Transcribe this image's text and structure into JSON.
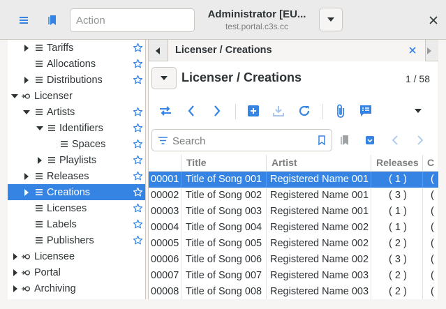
{
  "header": {
    "action_placeholder": "Action",
    "title": "Administrator [EU...",
    "subtitle": "test.portal.c3s.cc"
  },
  "tree": {
    "items": [
      {
        "label": "Tariffs"
      },
      {
        "label": "Allocations"
      },
      {
        "label": "Distributions"
      },
      {
        "label": "Licenser"
      },
      {
        "label": "Artists"
      },
      {
        "label": "Identifiers"
      },
      {
        "label": "Spaces"
      },
      {
        "label": "Playlists"
      },
      {
        "label": "Releases"
      },
      {
        "label": "Creations"
      },
      {
        "label": "Licenses"
      },
      {
        "label": "Labels"
      },
      {
        "label": "Publishers"
      },
      {
        "label": "Licensee"
      },
      {
        "label": "Portal"
      },
      {
        "label": "Archiving"
      }
    ]
  },
  "tab": {
    "label": "Licenser / Creations"
  },
  "view": {
    "title": "Licenser / Creations",
    "counter": "1 / 58"
  },
  "search": {
    "placeholder": "Search"
  },
  "table": {
    "columns": [
      "Title",
      "Artist",
      "Releases",
      "C"
    ],
    "rows": [
      {
        "code": "00001",
        "title": "Title of Song 001",
        "artist": "Registered Name 001",
        "releases": "( 1 )",
        "c": "("
      },
      {
        "code": "00002",
        "title": "Title of Song 002",
        "artist": "Registered Name 001",
        "releases": "( 3 )",
        "c": "("
      },
      {
        "code": "00003",
        "title": "Title of Song 003",
        "artist": "Registered Name 001",
        "releases": "( 1 )",
        "c": "("
      },
      {
        "code": "00004",
        "title": "Title of Song 004",
        "artist": "Registered Name 002",
        "releases": "( 1 )",
        "c": "("
      },
      {
        "code": "00005",
        "title": "Title of Song 005",
        "artist": "Registered Name 002",
        "releases": "( 2 )",
        "c": "("
      },
      {
        "code": "00006",
        "title": "Title of Song 006",
        "artist": "Registered Name 002",
        "releases": "( 3 )",
        "c": "("
      },
      {
        "code": "00007",
        "title": "Title of Song 007",
        "artist": "Registered Name 003",
        "releases": "( 2 )",
        "c": "("
      },
      {
        "code": "00008",
        "title": "Title of Song 008",
        "artist": "Registered Name 003",
        "releases": "( 2 )",
        "c": "("
      }
    ]
  },
  "colors": {
    "accent": "#3584e4",
    "star": "#3584e4"
  }
}
